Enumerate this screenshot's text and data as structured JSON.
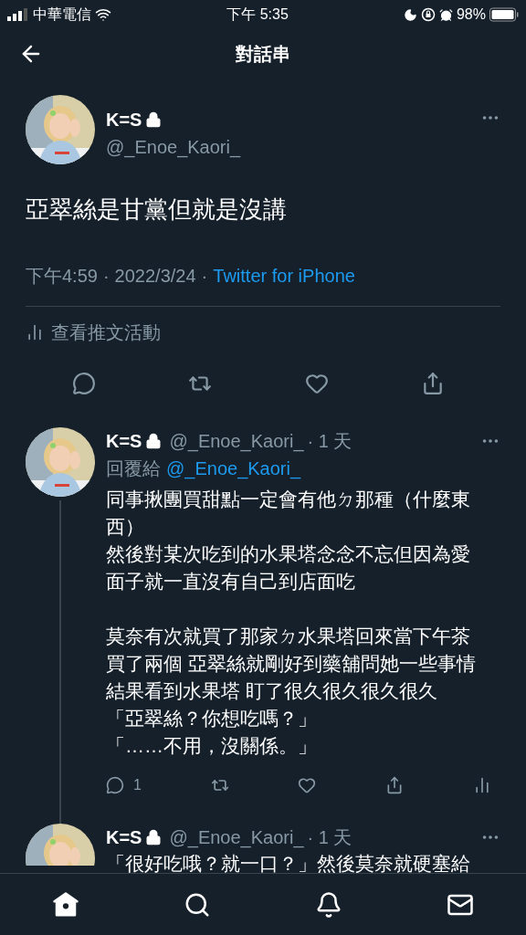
{
  "status_bar": {
    "carrier": "中華電信",
    "time": "下午 5:35",
    "battery": "98%"
  },
  "header": {
    "title": "對話串"
  },
  "main_tweet": {
    "name": "K=S",
    "handle": "@_Enoe_Kaori_",
    "text": "亞翠絲是甘黨但就是沒講",
    "time": "下午4:59",
    "date": "2022/3/24",
    "source": "Twitter for iPhone",
    "separator": "·",
    "activity_label": "查看推文活動"
  },
  "replies": [
    {
      "name": "K=S",
      "handle": "@_Enoe_Kaori_",
      "age": "· 1 天",
      "reply_to_label": "回覆給",
      "reply_to_handle": "@_Enoe_Kaori_",
      "paragraphs": [
        [
          "同事揪團買甜點一定會有他ㄉ那種（什麼東西）",
          "然後對某次吃到的水果塔念念不忘但因為愛面子就一直沒有自己到店面吃"
        ],
        [
          "莫奈有次就買了那家ㄉ水果塔回來當下午茶",
          "買了兩個 亞翠絲就剛好到藥舖問她一些事情",
          "結果看到水果塔 盯了很久很久很久很久",
          "「亞翠絲？你想吃嗎？」",
          "「……不用，沒關係。」"
        ]
      ],
      "reply_count": "1"
    },
    {
      "name": "K=S",
      "handle": "@_Enoe_Kaori_",
      "age": "· 1 天",
      "text": "「很好吃哦？就一口？」然後莫奈就硬塞給"
    }
  ],
  "tab_bar": [
    {
      "kind": "home",
      "selected": true
    },
    {
      "kind": "search",
      "selected": false
    },
    {
      "kind": "notifications",
      "selected": false
    },
    {
      "kind": "messages",
      "selected": false
    }
  ]
}
